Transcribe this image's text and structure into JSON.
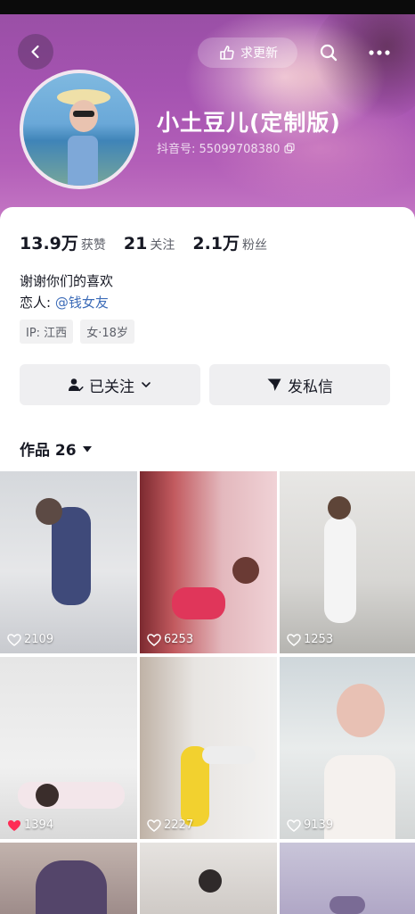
{
  "header": {
    "request_update_label": "求更新"
  },
  "profile": {
    "name": "小土豆儿(定制版)",
    "douyin_id": "抖音号: 55099708380"
  },
  "stats": [
    {
      "value": "13.9万",
      "label": "获赞"
    },
    {
      "value": "21",
      "label": "关注"
    },
    {
      "value": "2.1万",
      "label": "粉丝"
    }
  ],
  "bio": {
    "line1": "谢谢你们的喜欢",
    "lover_prefix": "恋人: ",
    "lover_mention": "@钱女友"
  },
  "tags": [
    "IP: 江西",
    "女·18岁"
  ],
  "actions": {
    "followed_label": "已关注",
    "message_label": "发私信"
  },
  "works_tab": {
    "label": "作品 26"
  },
  "videos": [
    {
      "likes": "2109",
      "liked": false
    },
    {
      "likes": "6253",
      "liked": false
    },
    {
      "likes": "1253",
      "liked": false
    },
    {
      "likes": "1394",
      "liked": true
    },
    {
      "likes": "2227",
      "liked": false
    },
    {
      "likes": "9139",
      "liked": false
    }
  ],
  "colors": {
    "cover_purple": "#a553b1",
    "mention_blue": "#3d6cb8",
    "liked_red": "#fe2c55"
  }
}
